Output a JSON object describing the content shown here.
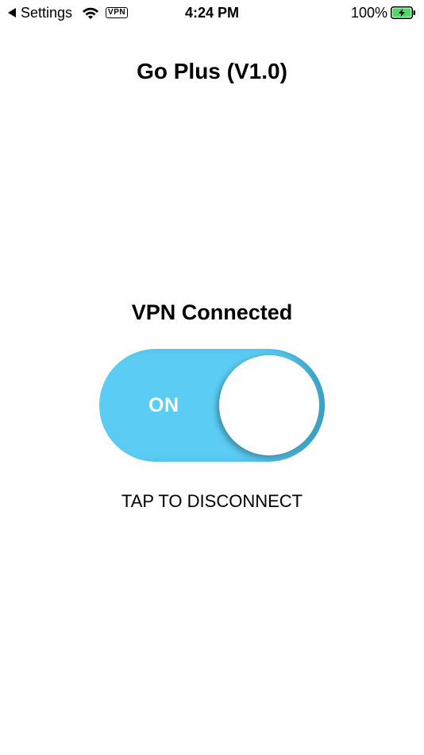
{
  "status_bar": {
    "back_label": "Settings",
    "vpn_badge": "VPN",
    "time": "4:24 PM",
    "battery_percent": "100%",
    "icons": [
      "back-triangle-icon",
      "wifi-icon",
      "vpn-badge",
      "battery-charging-icon"
    ]
  },
  "app": {
    "title": "Go Plus (V1.0)",
    "vpn_status": "VPN Connected",
    "toggle": {
      "state_label": "ON",
      "is_on": true
    },
    "tap_hint": "TAP TO DISCONNECT"
  },
  "colors": {
    "toggle_track": "#5bcdf4",
    "toggle_knob": "#ffffff",
    "battery_fill": "#4cd964",
    "text": "#000000",
    "background": "#ffffff"
  }
}
